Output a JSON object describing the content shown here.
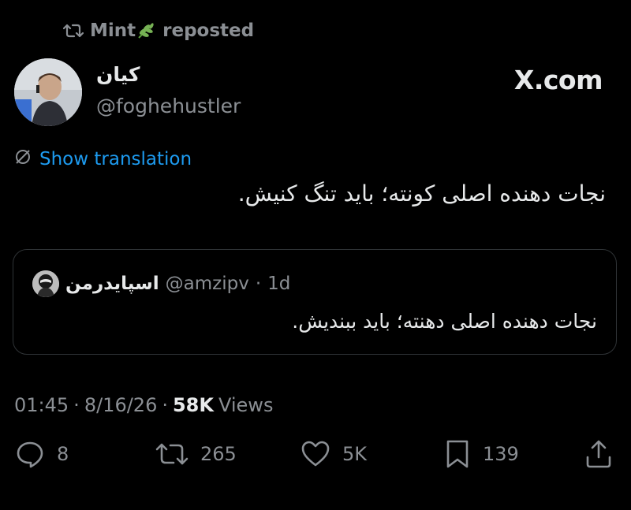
{
  "repost": {
    "name": "Mint",
    "label": "reposted"
  },
  "author": {
    "display_name": "کیان",
    "handle": "@foghehustler"
  },
  "brand": {
    "wordmark": "X.com"
  },
  "translate": {
    "label": "Show translation"
  },
  "tweet": {
    "text": "نجات دهنده اصلی کونته؛ باید تنگ کنیش."
  },
  "quote": {
    "display_name": "اسپایدرمن",
    "handle": "@amzipv",
    "separator": "·",
    "time": "1d",
    "text": "نجات دهنده اصلی دهنته؛ باید ببندیش."
  },
  "meta": {
    "time": "01:45",
    "sep1": "·",
    "date": "8/16/26",
    "sep2": "·",
    "views_count": "58K",
    "views_label": "Views"
  },
  "actions": {
    "replies": "8",
    "reposts": "265",
    "likes": "5K",
    "bookmarks": "139"
  },
  "icons": {
    "repost": "repost-icon",
    "leaf": "leaf-emoji-icon",
    "translate": "translate-icon",
    "reply": "reply-icon",
    "like": "heart-icon",
    "bookmark": "bookmark-icon",
    "share": "share-icon"
  },
  "colors": {
    "background": "#000000",
    "text": "#e7e9ea",
    "muted": "#8b8f94",
    "link": "#1d9bf0",
    "border": "#2f3336"
  }
}
